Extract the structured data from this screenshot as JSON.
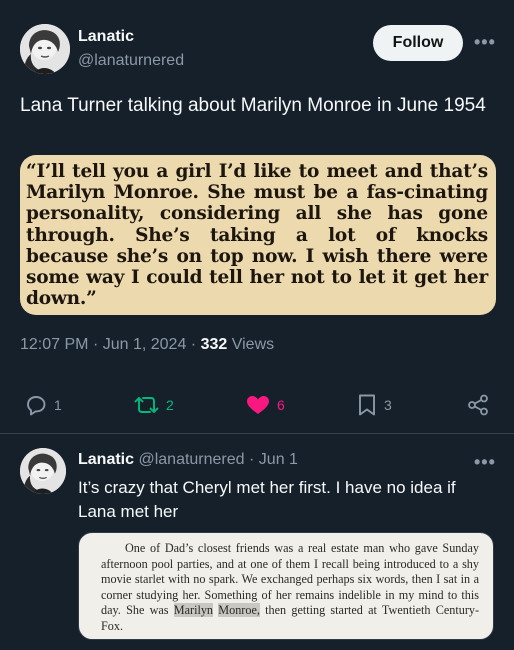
{
  "tweet": {
    "author_name": "Lanatic",
    "author_handle": "@lanaturnered",
    "follow_label": "Follow",
    "text": "Lana Turner talking about Marilyn Monroe in June 1954",
    "clipping_text": "“I’ll tell you a girl I’d like to meet and that’s Marilyn Monroe. She must be a fas-cinating personality, considering all she has gone through. She’s taking a lot of knocks because she’s on top now. I wish there were some way I could tell her not to let it get her down.”",
    "time": "12:07 PM",
    "date": "Jun 1, 2024",
    "views_count": "332",
    "views_label": "Views",
    "replies": "1",
    "retweets": "2",
    "likes": "6",
    "bookmarks": "3"
  },
  "reply": {
    "author_name": "Lanatic",
    "author_handle": "@lanaturnered",
    "date": "Jun 1",
    "text": "It’s crazy that Cheryl met her first. I have no idea if Lana met her",
    "quote_before": "One of Dad’s closest friends was a real estate man who gave Sunday afternoon pool parties, and at one of them I recall being introduced to a shy movie starlet with no spark. We exchanged perhaps six words, then I sat in a corner studying her. Something of her remains indelible in my mind to this day. She was",
    "quote_highlight_1": "Marilyn",
    "quote_highlight_2": "Monroe,",
    "quote_after": "then getting started at Twentieth Century-Fox."
  },
  "colors": {
    "background": "#15202b",
    "text_primary": "#f7f9f9",
    "text_secondary": "#8b98a5",
    "retweet_green": "#00ba7c",
    "like_pink": "#f91880",
    "follow_bg": "#eff3f4"
  },
  "icons": {
    "reply": "reply-icon",
    "retweet": "retweet-icon",
    "like": "heart-icon",
    "bookmark": "bookmark-icon",
    "share": "share-icon",
    "more": "more-icon"
  }
}
